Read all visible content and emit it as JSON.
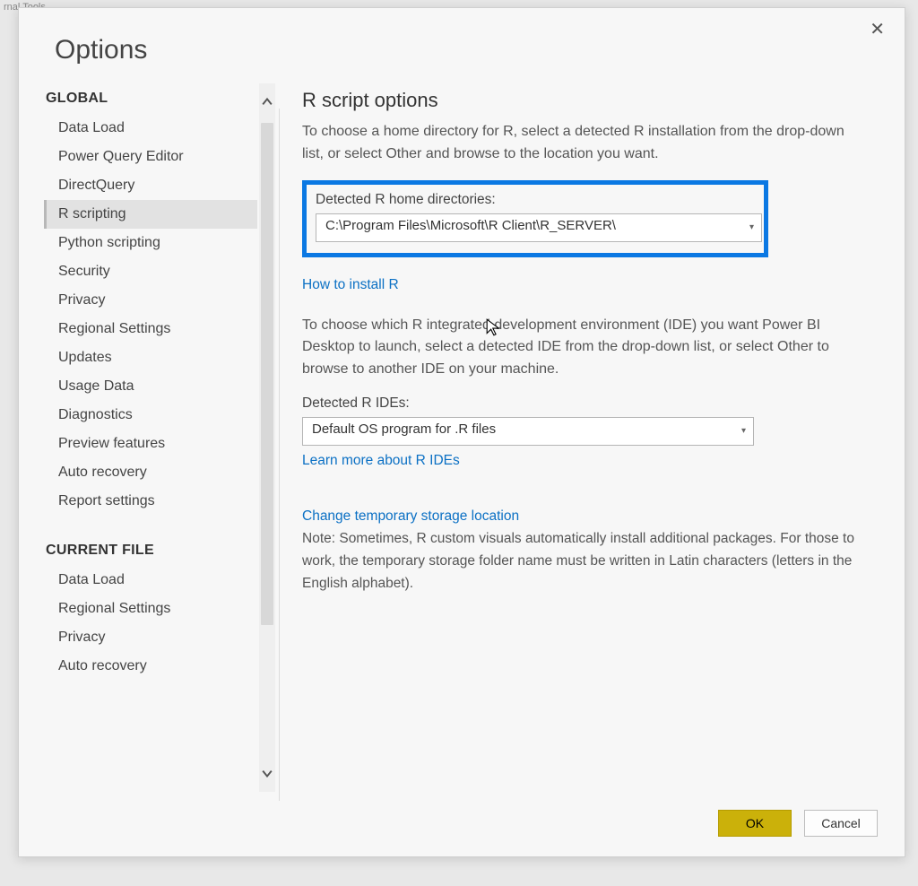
{
  "window": {
    "tab_hint": "rnal Tools",
    "title": "Options"
  },
  "sidebar": {
    "sections": [
      {
        "header": "GLOBAL",
        "items": [
          "Data Load",
          "Power Query Editor",
          "DirectQuery",
          "R scripting",
          "Python scripting",
          "Security",
          "Privacy",
          "Regional Settings",
          "Updates",
          "Usage Data",
          "Diagnostics",
          "Preview features",
          "Auto recovery",
          "Report settings"
        ],
        "selected_index": 3
      },
      {
        "header": "CURRENT FILE",
        "items": [
          "Data Load",
          "Regional Settings",
          "Privacy",
          "Auto recovery"
        ]
      }
    ]
  },
  "main": {
    "heading": "R script options",
    "intro": "To choose a home directory for R, select a detected R installation from the drop-down list, or select Other and browse to the location you want.",
    "r_home": {
      "label": "Detected R home directories:",
      "value": "C:\\Program Files\\Microsoft\\R Client\\R_SERVER\\",
      "install_link": "How to install R"
    },
    "ide_text": "To choose which R integrated development environment (IDE) you want Power BI Desktop to launch, select a detected IDE from the drop-down list, or select Other to browse to another IDE on your machine.",
    "r_ide": {
      "label": "Detected R IDEs:",
      "value": "Default OS program for .R files",
      "learn_link": "Learn more about R IDEs"
    },
    "temp": {
      "link": "Change temporary storage location",
      "note": "Note: Sometimes, R custom visuals automatically install additional packages. For those to work, the temporary storage folder name must be written in Latin characters (letters in the English alphabet)."
    }
  },
  "footer": {
    "ok": "OK",
    "cancel": "Cancel"
  }
}
